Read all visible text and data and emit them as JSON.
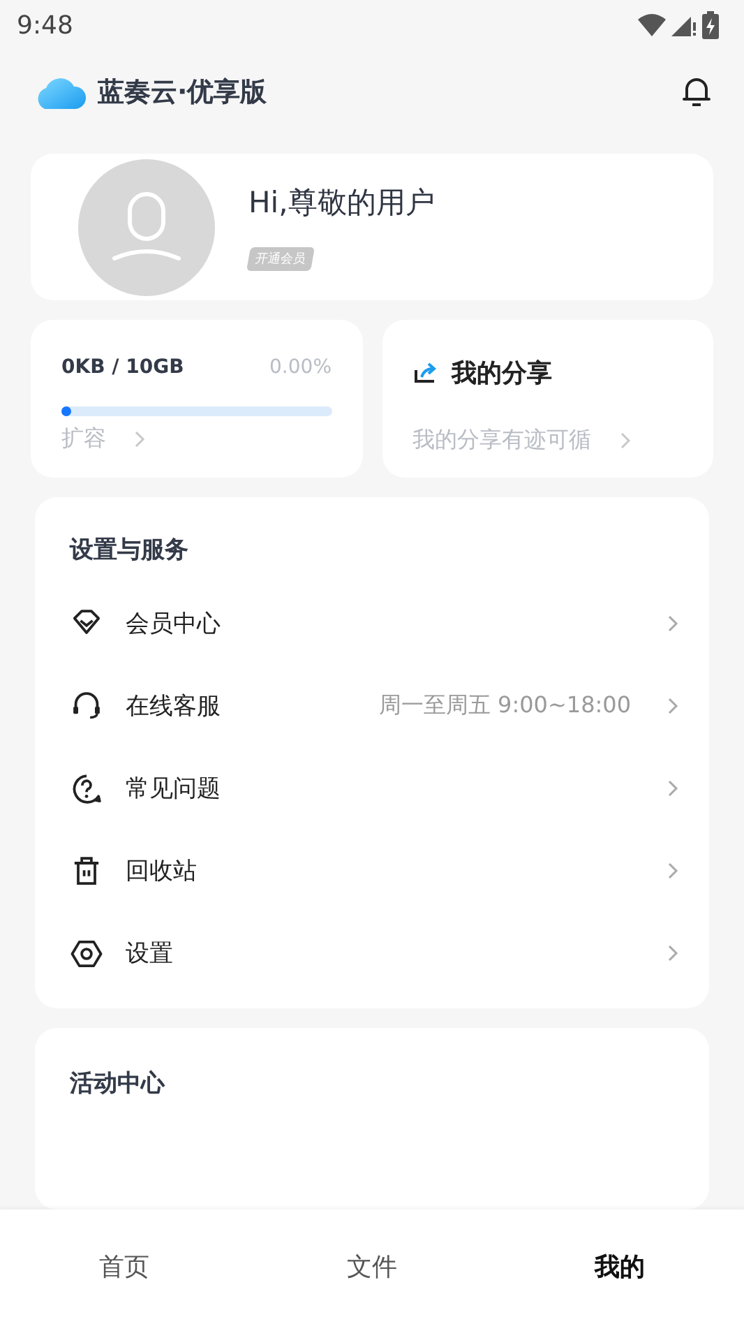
{
  "status_bar": {
    "time": "9:48"
  },
  "header": {
    "title": "蓝奏云·优享版"
  },
  "profile": {
    "greeting": "Hi,尊敬的用户",
    "badge": "开通会员"
  },
  "storage": {
    "usage": "0KB / 10GB",
    "percent": "0.00%",
    "level": 0,
    "action": "扩容"
  },
  "share": {
    "title": "我的分享",
    "subtitle": "我的分享有迹可循"
  },
  "settings": {
    "title": "设置与服务",
    "items": [
      {
        "label": "会员中心"
      },
      {
        "label": "在线客服",
        "detail": "周一至周五 9:00~18:00"
      },
      {
        "label": "常见问题"
      },
      {
        "label": "回收站"
      },
      {
        "label": "设置"
      }
    ]
  },
  "activity": {
    "title": "活动中心"
  },
  "tabs": [
    {
      "label": "首页",
      "selected": false
    },
    {
      "label": "文件",
      "selected": false
    },
    {
      "label": "我的",
      "selected": true
    }
  ]
}
